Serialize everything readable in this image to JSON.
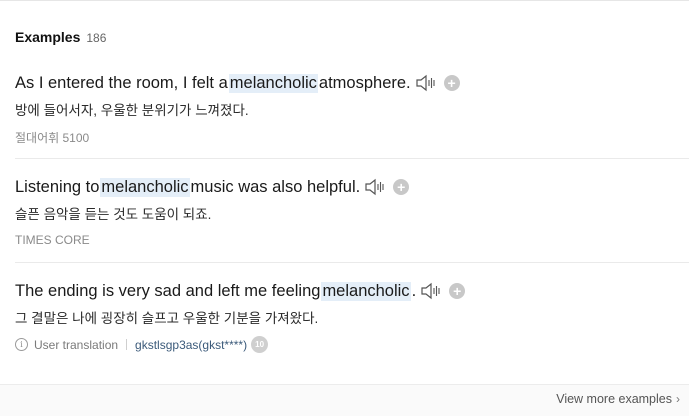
{
  "section": {
    "title": "Examples",
    "count": "186"
  },
  "examples": [
    {
      "en_before": "As I entered the room, I felt a",
      "en_highlight": "melancholic",
      "en_after": "atmosphere.",
      "ko": "방에 들어서자, 우울한 분위기가 느껴졌다.",
      "source": "절대어휘 5100"
    },
    {
      "en_before": "Listening to",
      "en_highlight": "melancholic",
      "en_after": "music was also helpful.",
      "ko": "슬픈 음악을 듣는 것도 도움이 되죠.",
      "source": "TIMES CORE"
    },
    {
      "en_before": "The ending is very sad and left me feeling",
      "en_highlight": "melancholic",
      "en_after": ".",
      "ko": "그 결말은 나에 굉장히 슬프고 우울한 기분을 가져왔다.",
      "user_translation_label": "User translation",
      "user_name": "gkstlsgp3as(gkst****)",
      "user_badge": "10"
    }
  ],
  "footer": {
    "view_more": "View more examples"
  },
  "icons": {
    "speaker": "speaker-icon",
    "add": "plus-circle-icon",
    "info": "info-icon",
    "chevron": "chevron-right-icon"
  }
}
